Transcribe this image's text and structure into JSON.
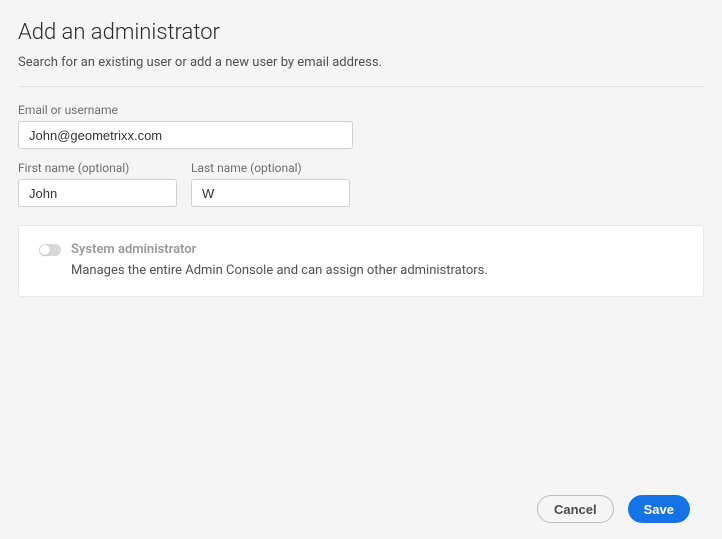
{
  "header": {
    "title": "Add an administrator",
    "subtitle": "Search for an existing user or add a new user by email address."
  },
  "form": {
    "email_label": "Email or username",
    "email_value": "John@geometrixx.com",
    "first_name_label": "First name (optional)",
    "first_name_value": "John",
    "last_name_label": "Last name (optional)",
    "last_name_value": "W"
  },
  "role": {
    "title": "System administrator",
    "description": "Manages the entire Admin Console and can assign other administrators."
  },
  "footer": {
    "cancel_label": "Cancel",
    "save_label": "Save"
  }
}
